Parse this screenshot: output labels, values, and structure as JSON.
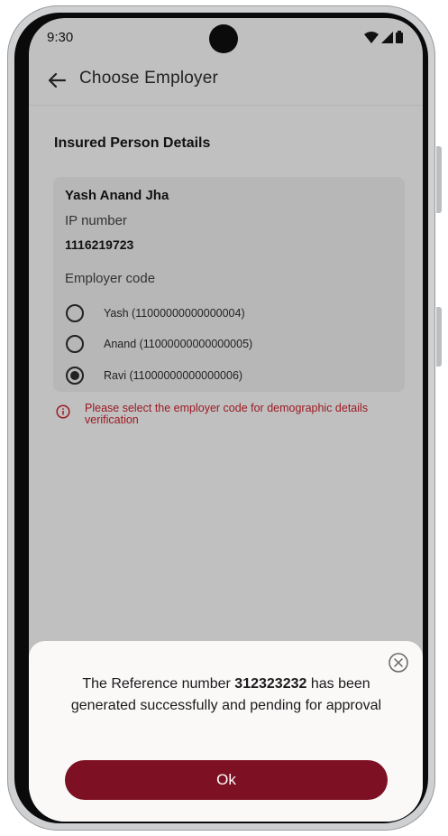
{
  "status_bar": {
    "time": "9:30"
  },
  "app_bar": {
    "title": "Choose Employer"
  },
  "section": {
    "title": "Insured Person Details"
  },
  "card": {
    "name": "Yash Anand Jha",
    "ip_label": "IP number",
    "ip_value": "1116219723",
    "employer_label": "Employer code",
    "employers": [
      {
        "label": "Yash (11000000000000004)",
        "selected": false
      },
      {
        "label": "Anand (11000000000000005)",
        "selected": false
      },
      {
        "label": "Ravi (11000000000000006)",
        "selected": true
      }
    ]
  },
  "error": {
    "text": "Please select the employer code for demographic details verification"
  },
  "dialog": {
    "message_before": "The Reference number ",
    "reference_number": "312323232",
    "message_after": " has been generated successfully and pending for approval",
    "ok_label": "Ok"
  },
  "colors": {
    "accent": "#7d1022",
    "error": "#9b1a22",
    "overlay": "#c0c0c0"
  },
  "icons": [
    "back-arrow-icon",
    "wifi-icon",
    "signal-icon",
    "battery-icon",
    "error-info-icon",
    "close-circle-icon"
  ]
}
